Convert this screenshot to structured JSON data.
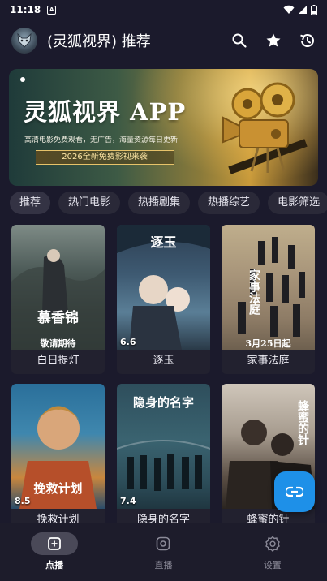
{
  "status_bar": {
    "time": "11:18",
    "notification_icon": "A"
  },
  "app_bar": {
    "title": "(灵狐视界) 推荐",
    "logo_icon": "fox-logo-icon",
    "actions": [
      "search-icon",
      "star-icon",
      "history-icon"
    ]
  },
  "banner": {
    "headline": "灵狐视界 APP",
    "subtitle": "高清电影免费观看，无广告，海量资源每日更新",
    "promo": "2026全新免费影视来袭"
  },
  "tabs": [
    "推荐",
    "热门电影",
    "热播剧集",
    "热播综艺",
    "电影筛选"
  ],
  "active_tab": 0,
  "movies": [
    {
      "title": "白日提灯",
      "rating": "",
      "poster_text": "慕香锦",
      "poster_sub": "敬请期待"
    },
    {
      "title": "逐玉",
      "rating": "6.6",
      "poster_text": "逐玉",
      "poster_sub": ""
    },
    {
      "title": "家事法庭",
      "rating": "",
      "poster_text": "家事法庭",
      "poster_sub": "3月25日起"
    },
    {
      "title": "挽救计划",
      "rating": "8.5",
      "poster_text": "挽救计划",
      "poster_sub": ""
    },
    {
      "title": "隐身的名字",
      "rating": "7.4",
      "poster_text": "隐身的名字",
      "poster_sub": ""
    },
    {
      "title": "蜂蜜的针",
      "rating": "",
      "poster_text": "蜂蜜的针",
      "poster_sub": ""
    }
  ],
  "fab_icon": "link-icon",
  "bottom_nav": [
    {
      "label": "点播",
      "icon": "play-square-icon"
    },
    {
      "label": "直播",
      "icon": "live-icon"
    },
    {
      "label": "设置",
      "icon": "settings-icon"
    }
  ],
  "active_nav": 0
}
